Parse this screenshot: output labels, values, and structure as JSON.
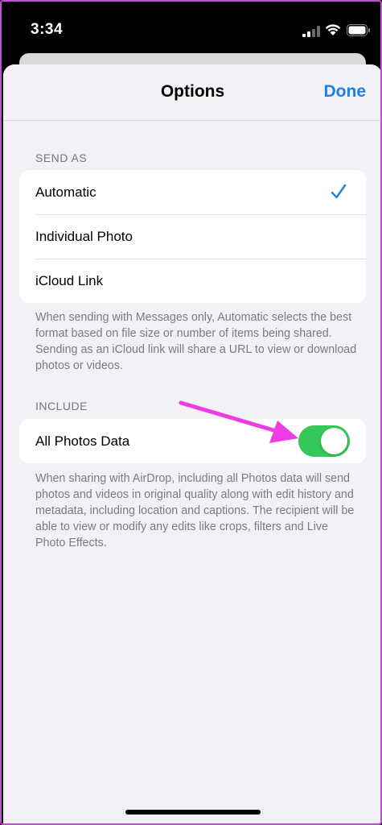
{
  "status_bar": {
    "time": "3:34",
    "icons": [
      "signal-icon",
      "wifi-icon",
      "battery-icon"
    ]
  },
  "nav": {
    "title": "Options",
    "done_label": "Done"
  },
  "send_as": {
    "header": "SEND AS",
    "options": [
      {
        "label": "Automatic",
        "selected": true
      },
      {
        "label": "Individual Photo",
        "selected": false
      },
      {
        "label": "iCloud Link",
        "selected": false
      }
    ],
    "footnote": "When sending with Messages only, Automatic selects the best format based on file size or number of items being shared. Sending as an iCloud link will share a URL to view or download photos or videos."
  },
  "include": {
    "header": "INCLUDE",
    "all_photos_data": {
      "label": "All Photos Data",
      "enabled": true
    },
    "footnote": "When sharing with AirDrop, including all Photos data will send photos and videos in original quality along with edit history and metadata, including location and captions. The recipient will be able to view or modify any edits like crops, filters and Live Photo Effects."
  },
  "colors": {
    "accent": "#1f7fe6",
    "toggle_on": "#34c759",
    "annotation_arrow": "#ee3be4",
    "frame_border": "#c04fd6"
  }
}
